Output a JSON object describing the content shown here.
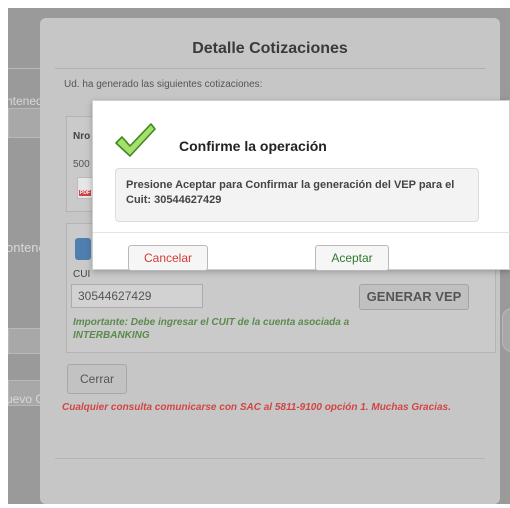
{
  "background": {
    "fragment_1": "ntenedor",
    "fragment_2": "ontene",
    "fragment_3": "uevo G"
  },
  "modal": {
    "title": "Detalle Cotizaciones",
    "subtitle": "Ud. ha generado las siguientes cotizaciones:",
    "table_header_nro": "Nro",
    "row_number": "500",
    "pdf_icon_label": "PDF",
    "cuit_label": "CUI",
    "cuit_value": "30544627429",
    "generar_button": "GENERAR VEP",
    "importante_note": "Importante: Debe ingresar el CUIT de la cuenta asociada a INTERBANKING",
    "cerrar_button": "Cerrar",
    "consulta_note": "Cualquier consulta comunicarse con SAC al 5811-9100 opción 1. Muchas Gracias."
  },
  "confirm": {
    "icon": "checkmark-icon",
    "title": "Confirme la operación",
    "message": "Presione Aceptar para Confirmar la generación del VEP para el Cuit: 30544627429",
    "cancel_button": "Cancelar",
    "accept_button": "Aceptar"
  },
  "colors": {
    "cancel_text": "#d23b3b",
    "accept_text": "#2e7a2e",
    "note_green": "#5b8b4c",
    "note_red": "#d24545",
    "check_green": "#6cbf3c"
  }
}
